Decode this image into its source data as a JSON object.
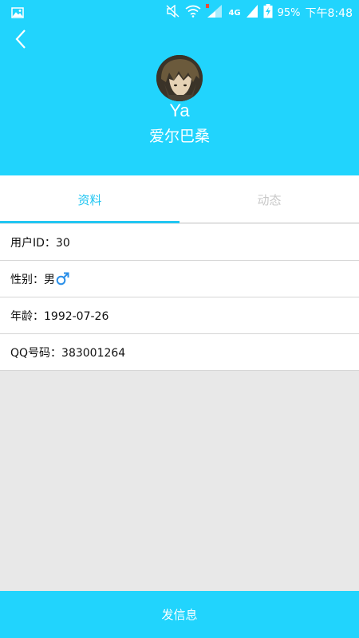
{
  "status_bar": {
    "battery": "95%",
    "time": "下午8:48",
    "network": "4G",
    "icons": [
      "gallery-icon",
      "mute-icon",
      "wifi-icon",
      "signal-icon",
      "battery-charging-icon"
    ]
  },
  "header": {
    "nickname": "Ya",
    "username": "爱尔巴桑",
    "back_icon": "chevron-left-icon"
  },
  "tabs": [
    {
      "label": "资料",
      "active": true
    },
    {
      "label": "动态",
      "active": false
    }
  ],
  "info": {
    "user_id": "用户ID：30",
    "gender": "性别：男",
    "gender_icon": "male-symbol-icon",
    "age": "年龄：1992-07-26",
    "qq": "QQ号码：383001264"
  },
  "footer": {
    "send_message_label": "发信息"
  },
  "colors": {
    "brand": "#21d4fd",
    "tab_active": "#21c6f2",
    "tab_inactive": "#c8c8c8",
    "male_icon": "#2a8fe8",
    "background": "#e8e8e8"
  }
}
